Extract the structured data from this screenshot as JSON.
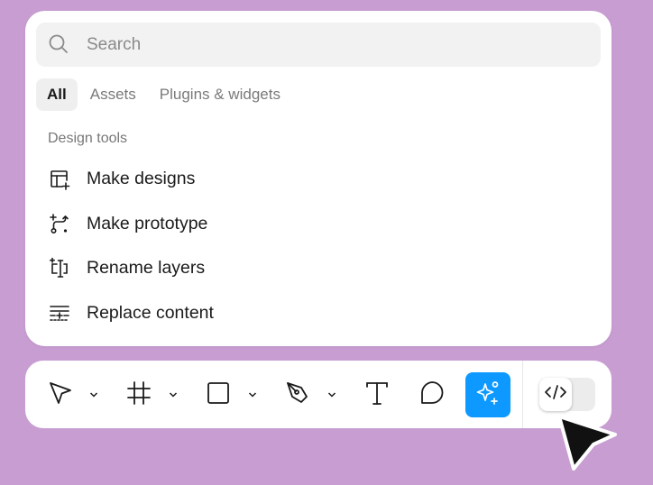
{
  "search": {
    "placeholder": "Search",
    "value": ""
  },
  "tabs": [
    {
      "label": "All",
      "active": true
    },
    {
      "label": "Assets",
      "active": false
    },
    {
      "label": "Plugins & widgets",
      "active": false
    }
  ],
  "section": {
    "title": "Design tools"
  },
  "items": [
    {
      "label": "Make designs",
      "icon": "layout-plus-icon"
    },
    {
      "label": "Make prototype",
      "icon": "prototype-icon"
    },
    {
      "label": "Rename layers",
      "icon": "rename-layers-icon"
    },
    {
      "label": "Replace content",
      "icon": "replace-content-icon"
    }
  ],
  "toolbar": {
    "tools": [
      "move-tool",
      "frame-tool",
      "shape-tool",
      "pen-tool",
      "text-tool",
      "comment-tool",
      "ai-tool"
    ],
    "active_tool": "ai-tool",
    "accent": "#0d99ff",
    "dev_mode_icon": "code-icon"
  },
  "colors": {
    "background": "#c89dd2",
    "panel": "#ffffff"
  }
}
